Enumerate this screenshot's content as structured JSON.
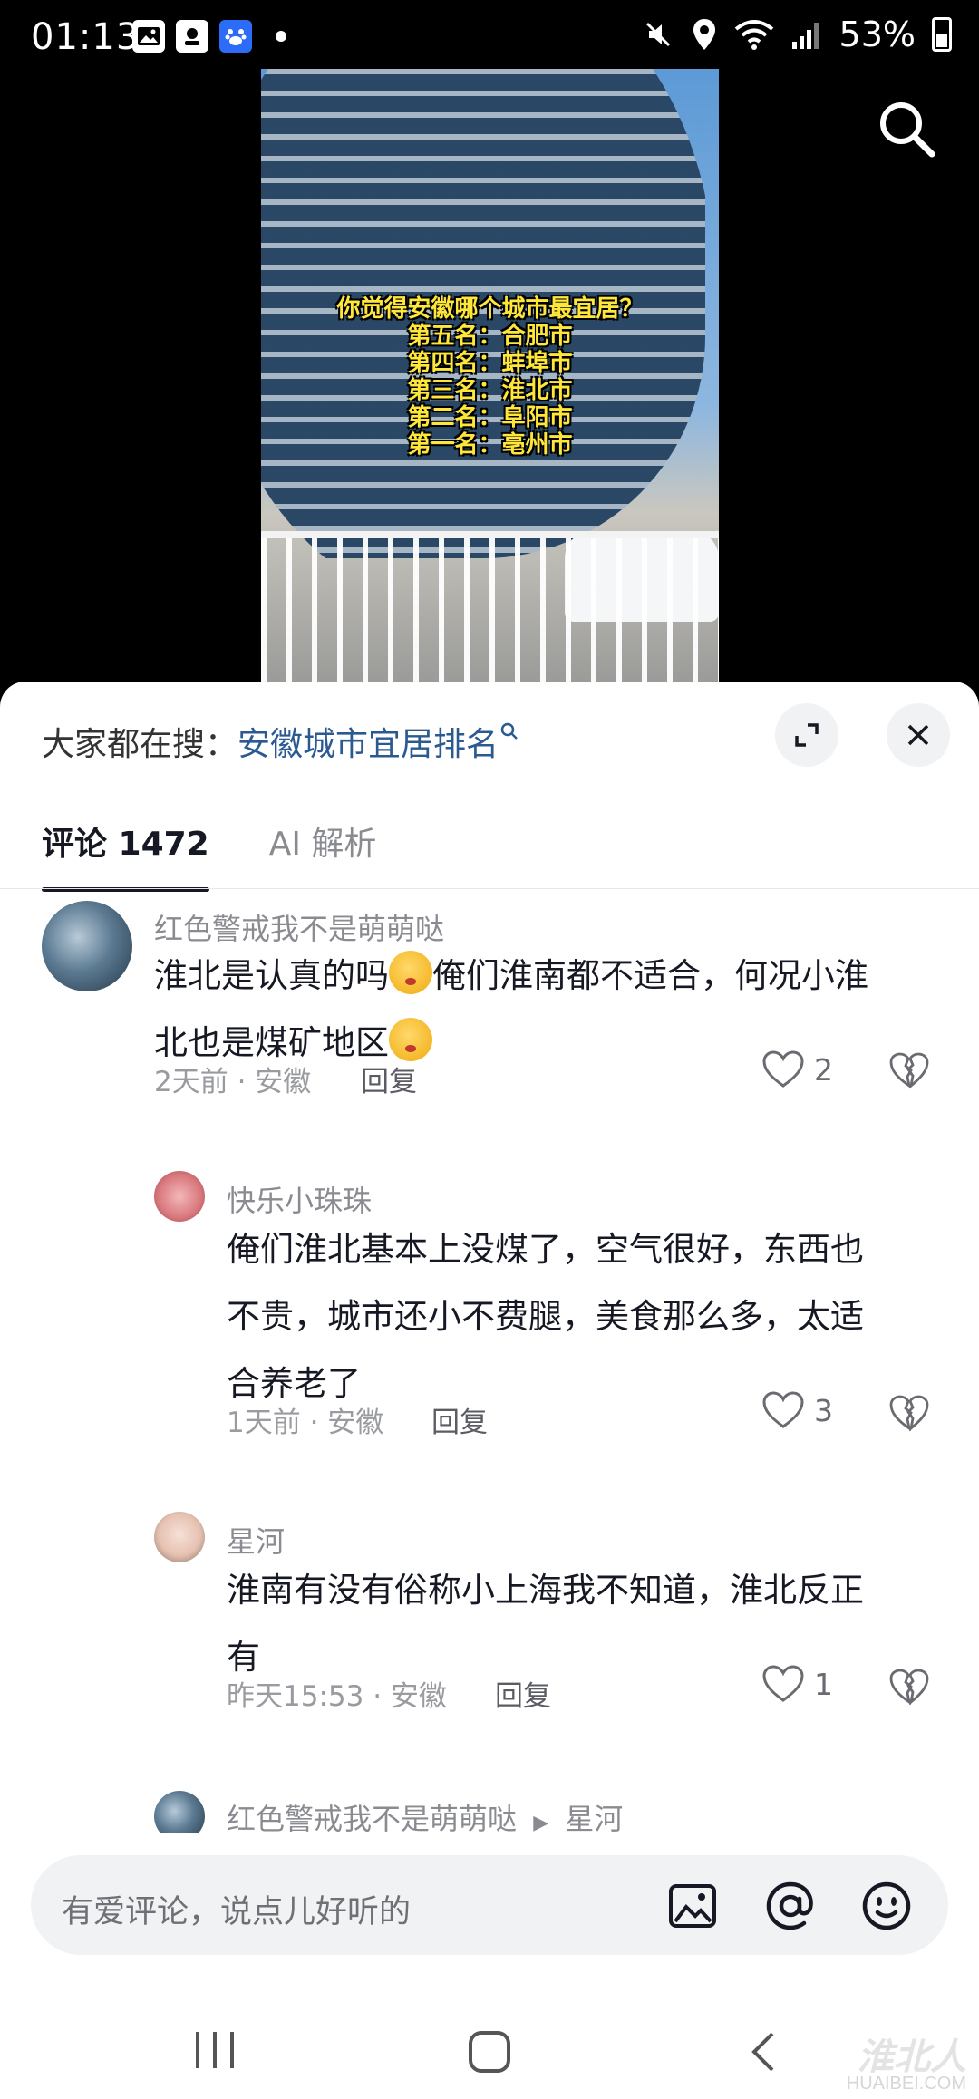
{
  "status_bar": {
    "time": "01:13",
    "battery": "53%"
  },
  "video": {
    "caption_lines": [
      "你觉得安徽哪个城市最宜居？",
      "第五名：合肥市",
      "第四名：蚌埠市",
      "第三名：淮北市",
      "第二名：阜阳市",
      "第一名：亳州市"
    ]
  },
  "panel": {
    "hot_search_label": "大家都在搜：",
    "hot_search_term": "安徽城市宜居排名",
    "tabs": {
      "comments": "评论 1472",
      "ai": "AI 解析"
    }
  },
  "comments": [
    {
      "username": "红色警戒我不是萌萌哒",
      "line1_a": "淮北是认真的吗",
      "line1_b": "俺们淮南都不适合，何况小淮",
      "line2": "北也是煤矿地区",
      "meta": "2天前 · 安徽",
      "reply": "回复",
      "likes": "2"
    },
    {
      "username": "快乐小珠珠",
      "lines": [
        "俺们淮北基本上没煤了，空气很好，东西也",
        "不贵，城市还小不费腿，美食那么多，太适",
        "合养老了"
      ],
      "meta": "1天前 · 安徽",
      "reply": "回复",
      "likes": "3"
    },
    {
      "username": "星河",
      "lines": [
        "淮南有没有俗称小上海我不知道，淮北反正",
        "有"
      ],
      "meta": "昨天15:53 · 安徽",
      "reply": "回复",
      "likes": "1"
    },
    {
      "username": "红色警戒我不是萌萌哒",
      "reply_to": "星河"
    }
  ],
  "input": {
    "placeholder": "有爱评论，说点儿好听的"
  },
  "watermark": {
    "line1": "淮北人",
    "line2": "HUAIBEI.COM"
  },
  "colors": {
    "accent_link": "#2b5a90",
    "caption_yellow": "#ffe63a"
  }
}
